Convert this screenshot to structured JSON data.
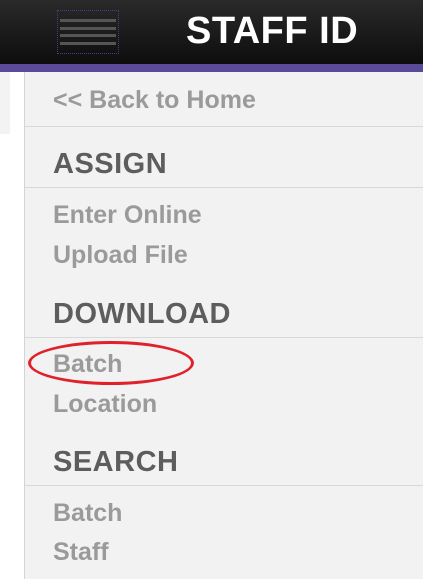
{
  "header": {
    "title": "STAFF ID",
    "menu_icon": "hamburger-menu-icon"
  },
  "sidebar": {
    "back_link": "<< Back to Home",
    "sections": [
      {
        "heading": "ASSIGN",
        "items": [
          "Enter Online",
          "Upload File"
        ]
      },
      {
        "heading": "DOWNLOAD",
        "items": [
          "Batch",
          "Location"
        ]
      },
      {
        "heading": "SEARCH",
        "items": [
          "Batch",
          "Staff"
        ]
      }
    ],
    "highlighted_item": "Batch"
  },
  "colors": {
    "header_bg": "#111111",
    "accent": "#5a4b9a",
    "highlight": "#e0202a",
    "link_text": "#9a9a9a",
    "section_text": "#5d5d5d"
  }
}
